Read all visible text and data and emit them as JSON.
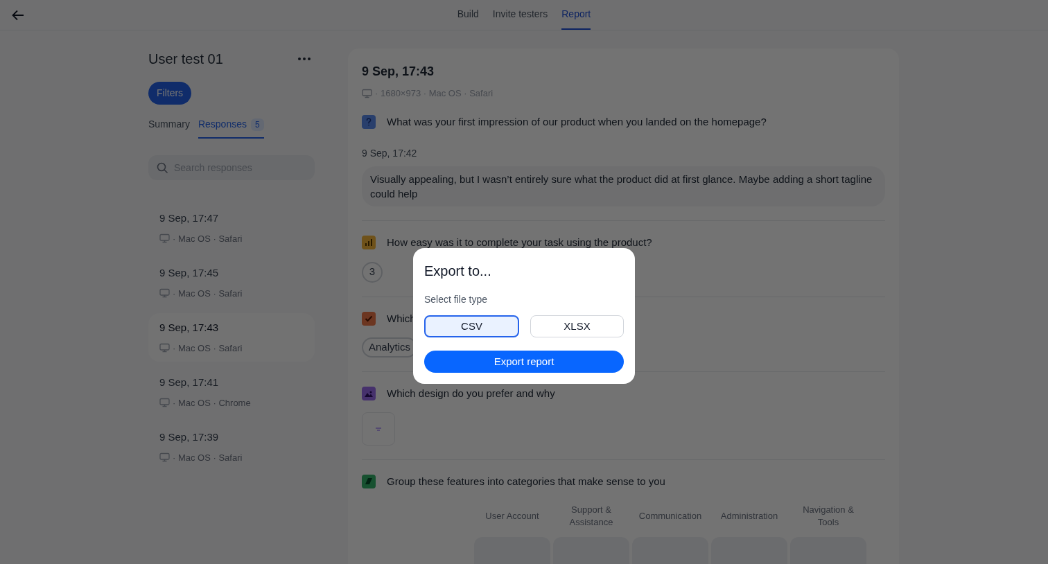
{
  "top_tabs": [
    {
      "label": "Build",
      "selected": false
    },
    {
      "label": "Invite testers",
      "selected": false
    },
    {
      "label": "Report",
      "selected": true
    }
  ],
  "sidebar": {
    "title": "User test 01",
    "filters_button": "Filters",
    "tabs": [
      {
        "label": "Summary",
        "selected": false
      },
      {
        "label": "Responses",
        "selected": true,
        "badge": "5"
      }
    ],
    "search": {
      "placeholder": "Search responses"
    },
    "responses": [
      {
        "date": "9 Sep, 17:47",
        "meta": "· Mac OS · Safari",
        "selected": false
      },
      {
        "date": "9 Sep, 17:45",
        "meta": "· Mac OS · Safari",
        "selected": false
      },
      {
        "date": "9 Sep, 17:43",
        "meta": "· Mac OS · Safari",
        "selected": true
      },
      {
        "date": "9 Sep, 17:41",
        "meta": "· Mac OS · Chrome",
        "selected": false
      },
      {
        "date": "9 Sep, 17:39",
        "meta": "· Mac OS · Safari",
        "selected": false
      }
    ]
  },
  "detail": {
    "date": "9 Sep, 17:43",
    "meta": "· 1680×973 · Mac OS · Safari",
    "questions": [
      {
        "kind": "open",
        "text": "What was your first impression of our product when you landed on the homepage?",
        "answer_date": "9 Sep, 17:42",
        "answer": "Visually appealing, but I wasn’t entirely sure what the product did at first glance. Maybe adding a short tagline could help"
      },
      {
        "kind": "rating",
        "text": "How easy was it to complete your task using the product?",
        "rating": "3"
      },
      {
        "kind": "choice",
        "text": "Which",
        "options": [
          "Analytics"
        ]
      },
      {
        "kind": "image",
        "text": "Which design do you prefer and why"
      },
      {
        "kind": "card_sort",
        "text": "Group these features into categories that make sense to you",
        "categories": [
          "User Account",
          "Support & Assistance",
          "Communication",
          "Administration",
          "Navigation & Tools"
        ]
      }
    ]
  },
  "modal": {
    "title": "Export to...",
    "label": "Select file type",
    "file_types": [
      {
        "label": "CSV",
        "selected": true
      },
      {
        "label": "XLSX",
        "selected": false
      }
    ],
    "button": "Export report"
  }
}
